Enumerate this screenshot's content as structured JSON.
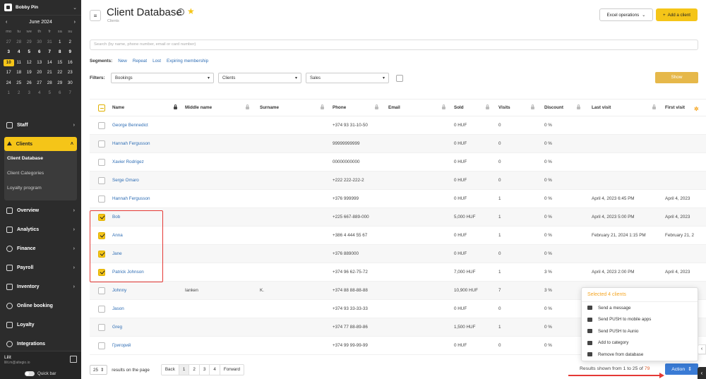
{
  "sidebar": {
    "user_name": "Bobby Pin",
    "calendar": {
      "month": "June 2024",
      "weekdays": [
        "mo",
        "tu",
        "we",
        "th",
        "fr",
        "sa",
        "su"
      ],
      "weeks": [
        [
          "27",
          "28",
          "29",
          "30",
          "31",
          "1",
          "2"
        ],
        [
          "3",
          "4",
          "5",
          "6",
          "7",
          "8",
          "9"
        ],
        [
          "10",
          "11",
          "12",
          "13",
          "14",
          "15",
          "16"
        ],
        [
          "17",
          "18",
          "19",
          "20",
          "21",
          "22",
          "23"
        ],
        [
          "24",
          "25",
          "26",
          "27",
          "28",
          "29",
          "30"
        ],
        [
          "1",
          "2",
          "3",
          "4",
          "5",
          "6",
          "7"
        ]
      ],
      "today": "10"
    },
    "staff": "Staff",
    "clients": "Clients",
    "client_database": "Client Database",
    "client_categories": "Client Categories",
    "loyalty_program": "Loyalty program",
    "overview": "Overview",
    "analytics": "Analytics",
    "finance": "Finance",
    "payroll": "Payroll",
    "inventory": "Inventory",
    "online_booking": "Online booking",
    "loyalty": "Loyalty",
    "integrations": "Integrations",
    "bottom_user": "Lilit",
    "bottom_email": "lilit.m@altegio.io",
    "quick_bar": "Quick bar"
  },
  "header": {
    "title": "Client Database",
    "breadcrumb": "Clients",
    "excel_operations": "Excel operations",
    "add_client": "Add a client"
  },
  "search": {
    "placeholder": "Search (by name, phone number, email or card number)"
  },
  "segments": {
    "label": "Segments:",
    "items": [
      "New",
      "Repeat",
      "Lost",
      "Expiring membership"
    ]
  },
  "filters": {
    "label": "Filters:",
    "bookings": "Bookings",
    "clients": "Clients",
    "sales": "Sales",
    "show": "Show"
  },
  "table": {
    "columns": [
      "Name",
      "Middle name",
      "Surname",
      "Phone",
      "Email",
      "Sold",
      "Visits",
      "Discount",
      "Last visit",
      "First visit"
    ],
    "rows": [
      {
        "name": "George Bennedict",
        "middle": "",
        "surname": "",
        "phone": "+374 93 31-10-50",
        "email": "",
        "sold": "0 HUF",
        "visits": "0",
        "discount": "0 %",
        "last": "",
        "first": "",
        "checked": false
      },
      {
        "name": "Hannah Fergusson",
        "middle": "",
        "surname": "",
        "phone": "99999999999",
        "email": "",
        "sold": "0 HUF",
        "visits": "0",
        "discount": "0 %",
        "last": "",
        "first": "",
        "checked": false
      },
      {
        "name": "Xavier Rodrigez",
        "middle": "",
        "surname": "",
        "phone": "00000000000",
        "email": "",
        "sold": "0 HUF",
        "visits": "0",
        "discount": "0 %",
        "last": "",
        "first": "",
        "checked": false
      },
      {
        "name": "Serge Omaro",
        "middle": "",
        "surname": "",
        "phone": "+222 222-222-2",
        "email": "",
        "sold": "0 HUF",
        "visits": "0",
        "discount": "0 %",
        "last": "",
        "first": "",
        "checked": false
      },
      {
        "name": "Hannah Fergusson",
        "middle": "",
        "surname": "",
        "phone": "+376 999999",
        "email": "",
        "sold": "0 HUF",
        "visits": "1",
        "discount": "0 %",
        "last": "April 4, 2023 6:45 PM",
        "first": "April 4, 2023",
        "checked": false
      },
      {
        "name": "Bob",
        "middle": "",
        "surname": "",
        "phone": "+225 667-889-000",
        "email": "",
        "sold": "5,000 HUF",
        "visits": "1",
        "discount": "0 %",
        "last": "April 4, 2023 5:00 PM",
        "first": "April 4, 2023",
        "checked": true
      },
      {
        "name": "Anna",
        "middle": "",
        "surname": "",
        "phone": "+386 4 444 55 67",
        "email": "",
        "sold": "0 HUF",
        "visits": "1",
        "discount": "0 %",
        "last": "February 21, 2024 1:15 PM",
        "first": "February 21, 2",
        "checked": true
      },
      {
        "name": "Jane",
        "middle": "",
        "surname": "",
        "phone": "+376 889000",
        "email": "",
        "sold": "0 HUF",
        "visits": "0",
        "discount": "0 %",
        "last": "",
        "first": "",
        "checked": true
      },
      {
        "name": "Patrick Johnson",
        "middle": "",
        "surname": "",
        "phone": "+374 96 62-75-72",
        "email": "",
        "sold": "7,000 HUF",
        "visits": "1",
        "discount": "3 %",
        "last": "April 4, 2023 2:00 PM",
        "first": "April 4, 2023",
        "checked": true
      },
      {
        "name": "Johnny",
        "middle": "Ianken",
        "surname": "K.",
        "phone": "+374 88 88-88-88",
        "email": "",
        "sold": "10,900 HUF",
        "visits": "7",
        "discount": "3 %",
        "last": "",
        "first": "",
        "checked": false
      },
      {
        "name": "Jason",
        "middle": "",
        "surname": "",
        "phone": "+374 93 33-33-33",
        "email": "",
        "sold": "0 HUF",
        "visits": "0",
        "discount": "0 %",
        "last": "",
        "first": "",
        "checked": false
      },
      {
        "name": "Greg",
        "middle": "",
        "surname": "",
        "phone": "+374 77 88-89-86",
        "email": "",
        "sold": "1,500 HUF",
        "visits": "1",
        "discount": "0 %",
        "last": "",
        "first": "",
        "checked": false
      },
      {
        "name": "Григорий",
        "middle": "",
        "surname": "",
        "phone": "+374 99 99-99-99",
        "email": "",
        "sold": "0 HUF",
        "visits": "0",
        "discount": "0 %",
        "last": "",
        "first": "",
        "checked": false
      }
    ]
  },
  "popup": {
    "title": "Selected 4 clients",
    "items": [
      "Send a message",
      "Send PUSH to mobile apps",
      "Send PUSH to Aunio",
      "Add to category",
      "Remove from database"
    ]
  },
  "footer": {
    "per_page": "25",
    "per_page_label": "results on the page",
    "back": "Back",
    "pages": [
      "1",
      "2",
      "3",
      "4"
    ],
    "forward": "Forward",
    "results_prefix": "Results shown from 1 to 25 of",
    "results_total": "79",
    "action": "Action"
  }
}
